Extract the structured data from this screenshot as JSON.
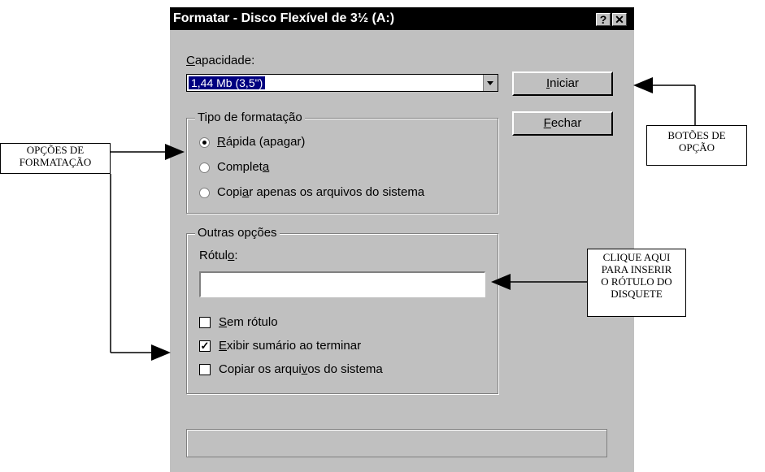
{
  "dialog": {
    "title": "Formatar - Disco Flexível de 3½ (A:)",
    "help_button": "?",
    "close_button": "✕",
    "capacity": {
      "label_prefix": "",
      "label_accel": "C",
      "label_rest": "apacidade:",
      "value": "1,44 Mb (3,5\")"
    },
    "buttons": {
      "start": {
        "accel": "I",
        "rest": "niciar"
      },
      "close": {
        "accel": "F",
        "rest": "echar"
      }
    },
    "format_type": {
      "title": "Tipo de formatação",
      "options": [
        {
          "pre": "",
          "accel": "R",
          "post": "ápida (apagar)",
          "checked": true
        },
        {
          "pre": "Complet",
          "accel": "a",
          "post": "",
          "checked": false
        },
        {
          "pre": "Copi",
          "accel": "a",
          "post": "r apenas os arquivos do sistema",
          "checked": false
        }
      ]
    },
    "other_options": {
      "title": "Outras opções",
      "label_field": {
        "pre": "Rótul",
        "accel": "o",
        "post": ":",
        "value": ""
      },
      "checkboxes": [
        {
          "pre": "",
          "accel": "S",
          "post": "em rótulo",
          "checked": false
        },
        {
          "pre": "",
          "accel": "E",
          "post": "xibir sumário ao terminar",
          "checked": true
        },
        {
          "pre": "Copiar os arqui",
          "accel": "v",
          "post": "os do sistema",
          "checked": false
        }
      ]
    }
  },
  "annotations": {
    "format_options": "OPÇÕES DE\nFORMATAÇÃO",
    "option_buttons": "BOTÕES DE\nOPÇÃO",
    "click_here": "CLIQUE AQUI\nPARA INSERIR\nO RÓTULO DO\nDISQUETE"
  }
}
